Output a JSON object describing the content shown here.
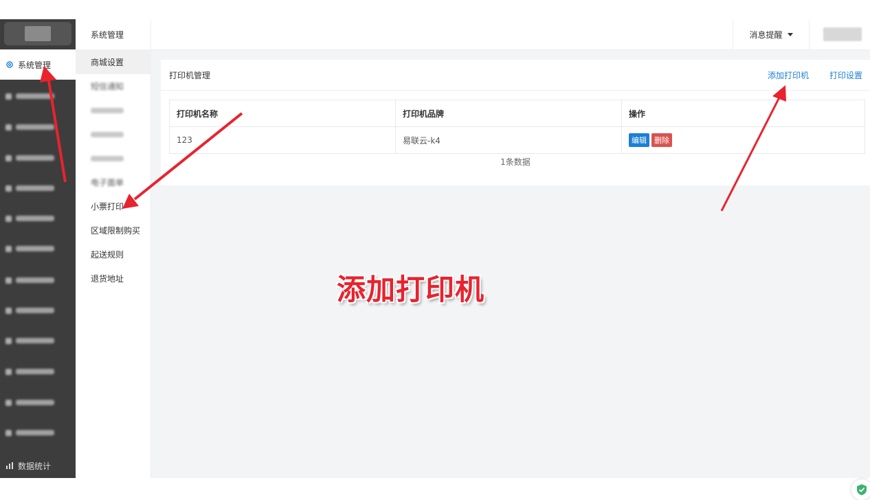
{
  "sidebar": {
    "active_label": "系统管理",
    "bottom_label": "数据统计"
  },
  "subnav": {
    "header": "系统管理",
    "items": [
      {
        "label": "商城设置"
      },
      {
        "label": "短信通知"
      },
      {
        "label": ""
      },
      {
        "label": ""
      },
      {
        "label": ""
      },
      {
        "label": "电子面单"
      },
      {
        "label": "小票打印"
      },
      {
        "label": "区域限制购买"
      },
      {
        "label": "起送规则"
      },
      {
        "label": "退货地址"
      }
    ]
  },
  "header": {
    "message_label": "消息提醒"
  },
  "panel": {
    "title": "打印机管理",
    "add_printer_link": "添加打印机",
    "print_settings_link": "打印设置",
    "table": {
      "headers": [
        "打印机名称",
        "打印机品牌",
        "操作"
      ],
      "rows": [
        {
          "name": "123",
          "brand": "易联云-k4",
          "edit_label": "编辑",
          "delete_label": "删除"
        }
      ]
    },
    "count_text": "1条数据"
  },
  "annotation": {
    "label": "添加打印机",
    "color": "#e8232e"
  },
  "colors": {
    "sidebar_bg": "#3d3d3d",
    "link": "#1a7fd6",
    "danger": "#d9534f"
  }
}
